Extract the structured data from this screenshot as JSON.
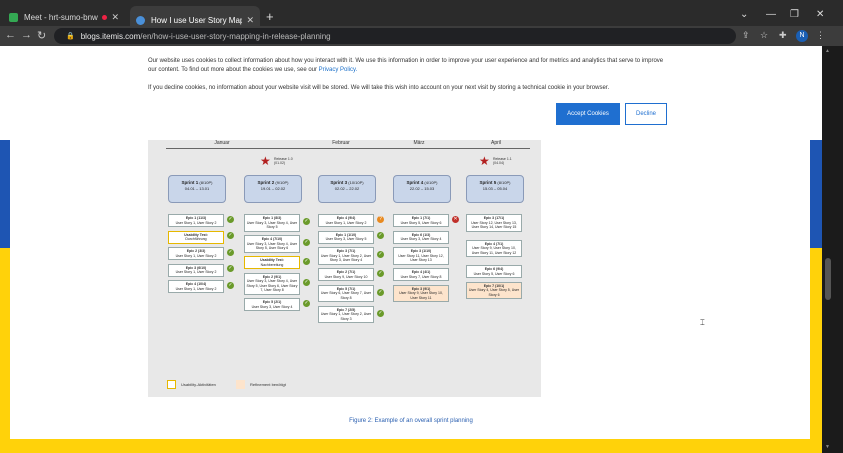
{
  "tabs": [
    {
      "label": "Meet - hrt-sumo-bnw",
      "favicon_color": "#34a853"
    },
    {
      "label": "How I use User Story Mapping in",
      "favicon_color": "#4a90d9"
    }
  ],
  "window_controls": [
    "⌄",
    "—",
    "❐",
    "✕"
  ],
  "address": {
    "host": "blogs.itemis.com",
    "path": "/en/how-i-use-user-story-mapping-in-release-planning"
  },
  "toolbar_icons": [
    "share-icon",
    "star-icon",
    "extensions-icon"
  ],
  "profile_initial": "N",
  "cookie": {
    "text1": "Our website uses cookies to collect information about how you interact with it. We use this information in order to improve your user experience and for metrics and analytics that serve to improve our content. To find out more about the cookies we use, see our ",
    "policy_link": "Privacy Policy.",
    "text2": "If you decline cookies, no information about your website visit will be stored. We will take this wish into account on your next visit by storing a technical cookie in your browser.",
    "accept": "Accept Cookies",
    "decline": "Decline"
  },
  "figure": {
    "months": [
      "Januar",
      "Februar",
      "März",
      "April"
    ],
    "releases": [
      {
        "name": "Release 1.0",
        "date": "(01.02)"
      },
      {
        "name": "Release 1.1",
        "date": "(04.04)"
      }
    ],
    "sprints": [
      {
        "name": "Sprint 1",
        "pts": "(8/10P)",
        "dates": "04.01 – 13.01"
      },
      {
        "name": "Sprint 2",
        "pts": "(9/10P)",
        "dates": "19.01 – 02.02"
      },
      {
        "name": "Sprint 3",
        "pts": "(10/10P)",
        "dates": "02.02 – 22.02"
      },
      {
        "name": "Sprint 4",
        "pts": "(4/10P)",
        "dates": "22.02 – 15.03"
      },
      {
        "name": "Sprint 5",
        "pts": "(8/10P)",
        "dates": "15.03 – 05.04"
      }
    ],
    "columns": [
      [
        {
          "epic": "Epic 1 (11/3)",
          "stories": "User Story 1, User Story 2",
          "mark": "check"
        },
        {
          "epic": "Usability Test:",
          "stories": "Durchführung",
          "mark": "check",
          "style": "y"
        },
        {
          "epic": "Epic 2 (3/3)",
          "stories": "User Story 1, User Story 2",
          "mark": "check"
        },
        {
          "epic": "Epic 3 (6/10)",
          "stories": "User Story 1, User Story 2",
          "mark": "check"
        },
        {
          "epic": "Epic 4 (10/4)",
          "stories": "User Story 1, User Story 2",
          "mark": "check"
        }
      ],
      [
        {
          "epic": "Epic 1 (8/3)",
          "stories": "User Story 3, User Story 4, User Story 5",
          "mark": "check"
        },
        {
          "epic": "Epic 4 (7/10)",
          "stories": "User Story 3, User Story 4, User Story 5, User Story 6",
          "mark": "check"
        },
        {
          "epic": "Usability Test:",
          "stories": "Nachbereitung",
          "mark": "check",
          "style": "y"
        },
        {
          "epic": "Epic 2 (9/1)",
          "stories": "User Story 3, User Story 4, User Story 5, User Story 6, User Story 7, User Story 8",
          "mark": "check"
        },
        {
          "epic": "Epic 5 (2/1)",
          "stories": "User Story 3, User Story 4",
          "mark": "check"
        }
      ],
      [
        {
          "epic": "Epic 4 (9/4)",
          "stories": "User Story 1, User Story 2",
          "mark": "q"
        },
        {
          "epic": "Epic 1 (1/10)",
          "stories": "User Story 3, User Story 5",
          "mark": "check"
        },
        {
          "epic": "Epic 3 (7/1)",
          "stories": "User Story 1, User Story 2, User Story 3, User Story 4",
          "mark": "check"
        },
        {
          "epic": "Epic 2 (7/1)",
          "stories": "User Story 9, User Story 10",
          "mark": "check"
        },
        {
          "epic": "Epic 5 (7/1)",
          "stories": "User Story 6, User Story 7, User Story 8",
          "mark": "check"
        },
        {
          "epic": "Epic 7 (2/5)",
          "stories": "User Story 1, User Story 2, User Story 3",
          "mark": "check"
        }
      ],
      [
        {
          "epic": "Epic 1 (7/1)",
          "stories": "User Story 5, User Story 6",
          "mark": "x"
        },
        {
          "epic": "Epic 6 (1/3)",
          "stories": "User Story 3, User Story 4",
          "mark": "none"
        },
        {
          "epic": "Epic 3 (1/10)",
          "stories": "User Story 11, User Story 12, User Story 13",
          "mark": "none"
        },
        {
          "epic": "Epic 4 (4/1)",
          "stories": "User Story 7, User Story 8",
          "mark": "none"
        },
        {
          "epic": "Epic 3 (9/1)",
          "stories": "User Story 9, User Story 10, User Story 11",
          "mark": "none",
          "style": "p"
        }
      ],
      [
        {
          "epic": "Epic 3 (17/1)",
          "stories": "User Story 12, User Story 13, User Story 14, User Story 15",
          "mark": "none"
        },
        {
          "epic": "Epic 4 (7/1)",
          "stories": "User Story 9, User Story 10, User Story 11, User Story 12",
          "mark": "none"
        },
        {
          "epic": "Epic 6 (9/4)",
          "stories": "User Story 5, User Story 6",
          "mark": "none"
        },
        {
          "epic": "Epic 7 (10/1)",
          "stories": "User Story 4, User Story 5, User Story 6",
          "mark": "none",
          "style": "p"
        }
      ]
    ],
    "legend": [
      {
        "label": "Usability-Aktivitäten",
        "color": "#e6b800"
      },
      {
        "label": "Refinement benötigt",
        "color": "#fde4cc"
      }
    ]
  },
  "caption": "Figure 2: Example of an overall sprint planning",
  "colors": {
    "band_top": "#1e55b3",
    "band_bottom": "#ffd20a",
    "accent": "#1f6fd0"
  }
}
